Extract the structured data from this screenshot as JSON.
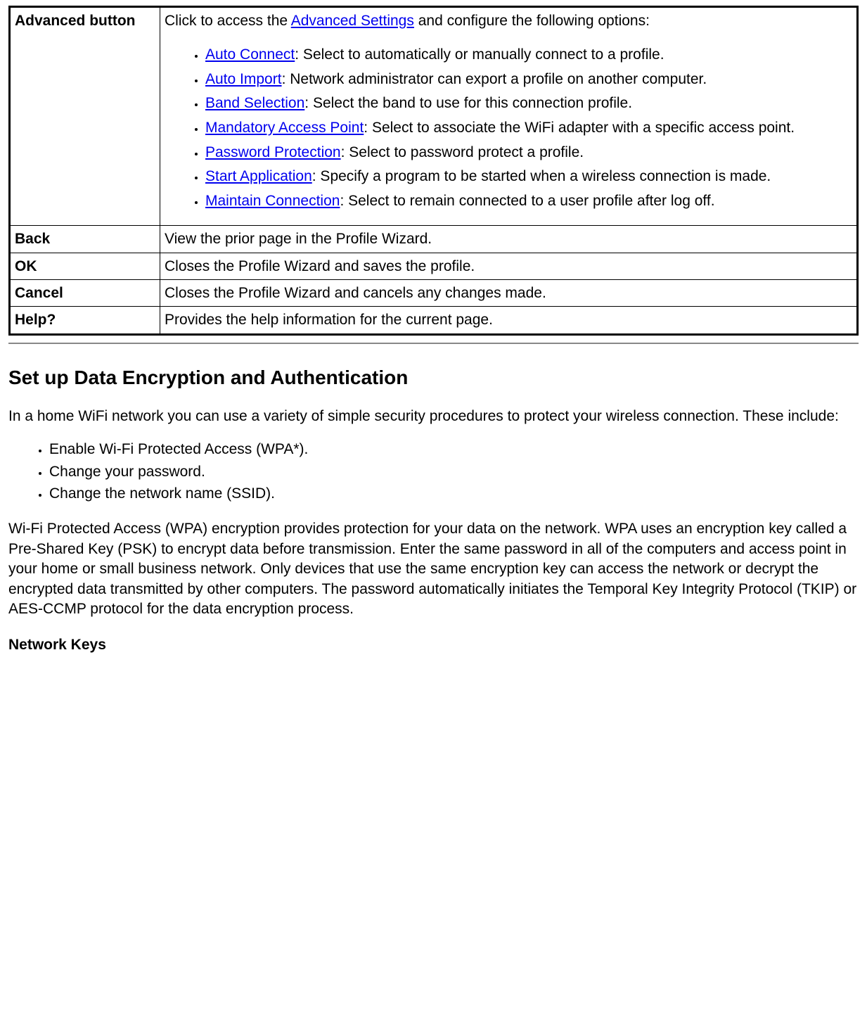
{
  "table": {
    "rows": [
      {
        "label": "Advanced button",
        "intro_pre": "Click to access the ",
        "intro_link": "Advanced Settings",
        "intro_post": " and configure the following options:",
        "items": [
          {
            "link": "Auto Connect",
            "desc": ": Select to automatically or manually connect to a profile."
          },
          {
            "link": "Auto Import",
            "desc": ": Network administrator can export a profile on another computer."
          },
          {
            "link": "Band Selection",
            "desc": ": Select the band to use for this connection profile."
          },
          {
            "link": "Mandatory Access Point",
            "desc": ": Select to associate the WiFi adapter with a specific access point."
          },
          {
            "link": "Password Protection",
            "desc": ": Select to password protect a profile."
          },
          {
            "link": "Start Application",
            "desc": ": Specify a program to be started when a wireless connection is made."
          },
          {
            "link": "Maintain Connection",
            "desc": ": Select to remain connected to a user profile after log off."
          }
        ]
      },
      {
        "label": "Back",
        "desc": "View the prior page in the Profile Wizard."
      },
      {
        "label": "OK",
        "desc": "Closes the Profile Wizard and saves the profile."
      },
      {
        "label": "Cancel",
        "desc": "Closes the Profile Wizard and cancels any changes made."
      },
      {
        "label": "Help?",
        "desc": "Provides the help information for the current page."
      }
    ]
  },
  "section": {
    "heading": "Set up Data Encryption and Authentication",
    "intro": "In a home WiFi network you can use a variety of simple security procedures to protect your wireless connection. These include:",
    "bullets": [
      "Enable Wi-Fi Protected Access (WPA*).",
      "Change your password.",
      "Change the network name (SSID)."
    ],
    "para": "Wi-Fi Protected Access (WPA) encryption provides protection for your data on the network. WPA uses an encryption key called a Pre-Shared Key (PSK) to encrypt data before transmission. Enter the same password in all of the computers and access point in your home or small business network. Only devices that use the same encryption key can access the network or decrypt the encrypted data transmitted by other computers. The password automatically initiates the Temporal Key Integrity Protocol (TKIP) or AES-CCMP protocol for the data encryption process.",
    "subhead": "Network Keys"
  }
}
